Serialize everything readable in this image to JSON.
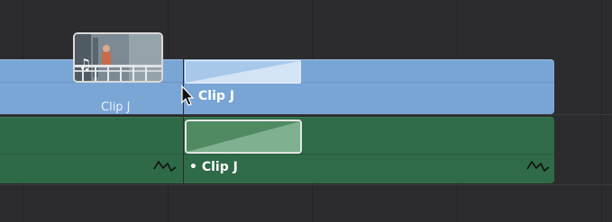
{
  "timeline": {
    "video_track": {
      "left_clip_label": "Clip J",
      "right_clip_label": "Clip J"
    },
    "audio_track": {
      "clip_label": "• Clip J"
    },
    "icons": {
      "thumbnail_music": "♫",
      "waveform": "audio-waveform-icon",
      "cursor": "mouse-pointer-icon"
    },
    "colors": {
      "background": "#2c2c2e",
      "video_clip": "#79a5d6",
      "audio_clip": "#2f6b48",
      "label": "#ffffff"
    }
  }
}
